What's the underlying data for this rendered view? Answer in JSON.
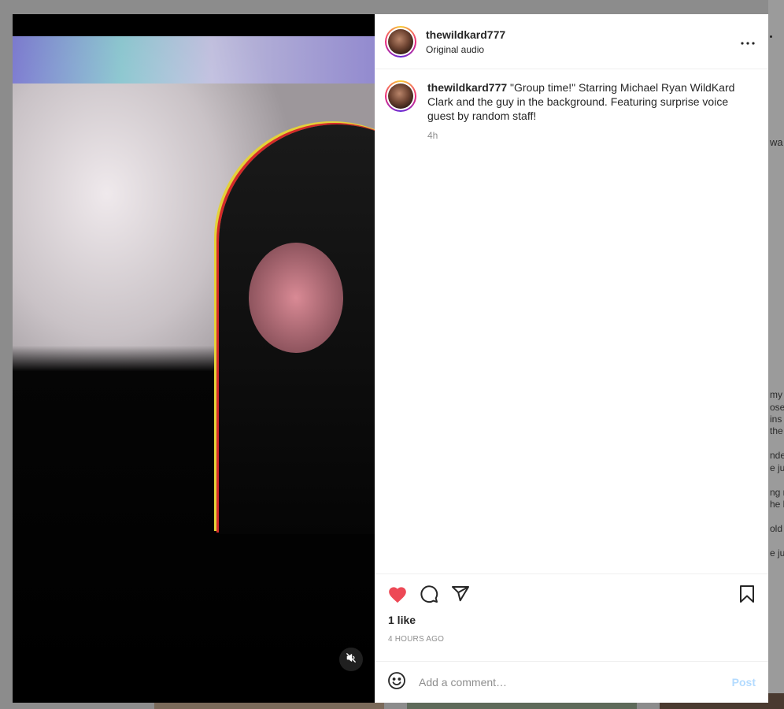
{
  "post": {
    "username": "thewildkard777",
    "audio": "Original audio",
    "caption_username": "thewildkard777",
    "caption_text": " \"Group time!\" Starring Michael Ryan WildKard Clark and the guy in the background. Featuring surprise voice guest by random staff!",
    "time_ago_short": "4h",
    "likes": "1 like",
    "time_ago_long": "4 HOURS AGO"
  },
  "comment": {
    "placeholder": "Add a comment…",
    "post_label": "Post"
  },
  "background_fragments": [
    "wa",
    "my c",
    "ose",
    "ins l",
    "the",
    "nde",
    "e jus",
    "ng m",
    "he b",
    "old e",
    "e ju"
  ],
  "icons": {
    "more": "more-horizontal-icon",
    "like": "heart-filled-icon",
    "comment": "comment-icon",
    "share": "paper-plane-icon",
    "save": "bookmark-icon",
    "emoji": "emoji-icon",
    "mute": "muted-speaker-icon"
  },
  "colors": {
    "like_red": "#ed4956",
    "post_disabled_blue": "#b3dbff",
    "text_primary": "#262626",
    "text_secondary": "#8e8e8e"
  }
}
